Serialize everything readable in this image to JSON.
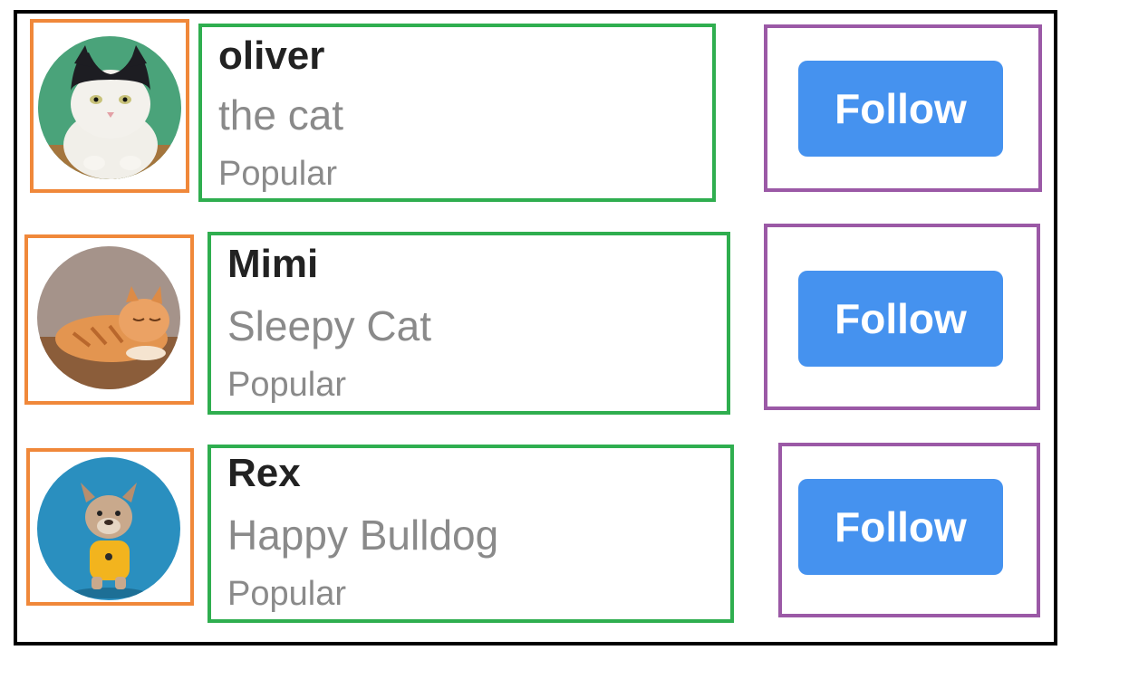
{
  "rows": [
    {
      "name": "oliver",
      "subtitle": "the cat",
      "tag": "Popular",
      "button_label": "Follow",
      "avatar_icon": "cat-photo-black-white"
    },
    {
      "name": "Mimi",
      "subtitle": "Sleepy Cat",
      "tag": "Popular",
      "button_label": "Follow",
      "avatar_icon": "cat-photo-orange-tabby"
    },
    {
      "name": "Rex",
      "subtitle": "Happy Bulldog",
      "tag": "Popular",
      "button_label": "Follow",
      "avatar_icon": "dog-photo-french-bulldog"
    }
  ],
  "colors": {
    "avatar_outline": "#f0883a",
    "text_outline": "#2fae4f",
    "action_outline": "#9b59a6",
    "button_bg": "#4592ef",
    "name_text": "#222222",
    "secondary_text": "#8a8a8a"
  }
}
